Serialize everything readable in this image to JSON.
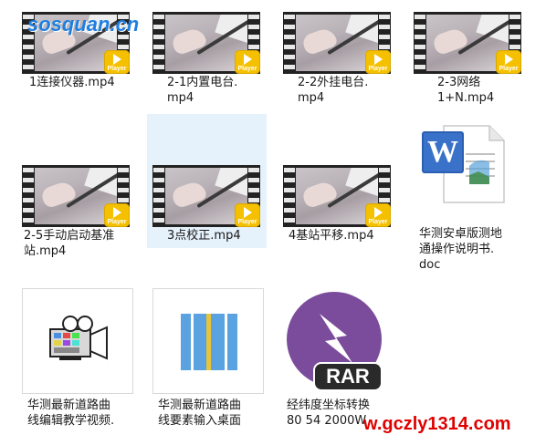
{
  "watermarks": {
    "top_left": "sosquan.cn",
    "bottom_right": "w.gczly1314.com"
  },
  "badge": {
    "player": "Player",
    "rar": "RAR"
  },
  "icons": {
    "word_letter": "W"
  },
  "colors": {
    "selection": "#e5f1fb",
    "player_badge": "#f5c000",
    "rar_purple": "#7b4c9b",
    "word_blue": "#2b5fb3",
    "road_blue": "#5aa3e0",
    "road_center": "#e9c43a",
    "watermark_top": "#1f7fe0",
    "watermark_bottom": "#e00000"
  },
  "files": [
    {
      "name": "1连接仪器.mp4"
    },
    {
      "name": "2-1内置电台.\nmp4"
    },
    {
      "name": "2-2外挂电台.\nmp4"
    },
    {
      "name": "2-3网络\n1+N.mp4"
    },
    {
      "name": "2-5手动启动基准\n站.mp4"
    },
    {
      "name": "3点校正.mp4"
    },
    {
      "name": "4基站平移.mp4"
    },
    {
      "name": "华测安卓版测地\n通操作说明书.\ndoc"
    },
    {
      "name": "华测最新道路曲\n线编辑教学视频."
    },
    {
      "name": "华测最新道路曲\n线要素输入桌面"
    },
    {
      "name": "经纬度坐标转换\n80 54 2000W"
    }
  ]
}
